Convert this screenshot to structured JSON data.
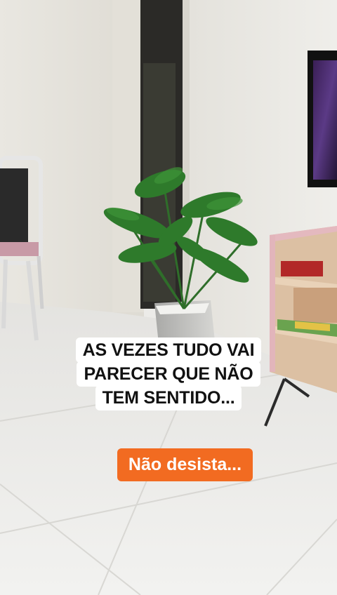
{
  "captions": {
    "main_lines": [
      "AS VEZES TUDO VAI",
      "PARECER QUE NÃO",
      "TEM SENTIDO..."
    ],
    "sub": "Não desista..."
  },
  "colors": {
    "caption_bg": "#ffffff",
    "caption_text": "#111111",
    "sub_bg": "#f26b21",
    "sub_text": "#ffffff"
  }
}
